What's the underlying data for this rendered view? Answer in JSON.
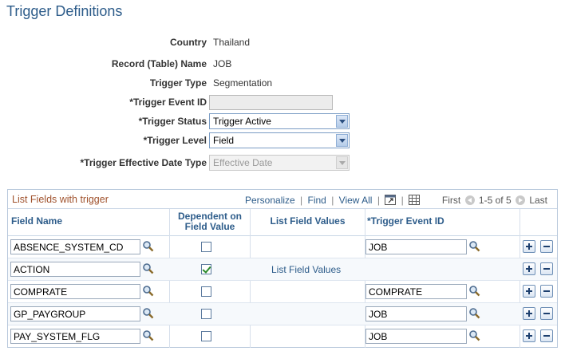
{
  "page": {
    "title": "Trigger Definitions"
  },
  "form": {
    "country": {
      "label": "Country",
      "value": "Thailand"
    },
    "record_name": {
      "label": "Record (Table) Name",
      "value": "JOB"
    },
    "trigger_type": {
      "label": "Trigger Type",
      "value": "Segmentation"
    },
    "trigger_event_id": {
      "label": "*Trigger Event ID",
      "value": ""
    },
    "trigger_status": {
      "label": "*Trigger Status",
      "value": "Trigger Active"
    },
    "trigger_level": {
      "label": "*Trigger Level",
      "value": "Field"
    },
    "trigger_eff_date_type": {
      "label": "*Trigger Effective Date Type",
      "value": "Effective Date"
    }
  },
  "grid": {
    "title": "List Fields with trigger",
    "nav": {
      "personalize": "Personalize",
      "find": "Find",
      "view_all": "View All",
      "separator": "|"
    },
    "pager": {
      "first": "First",
      "range": "1-5 of 5",
      "last": "Last"
    },
    "columns": {
      "field_name": "Field Name",
      "dependent_line1": "Dependent on",
      "dependent_line2": "Field Value",
      "list_field_values": "List Field Values",
      "trigger_event_id": "*Trigger Event ID"
    },
    "rows": [
      {
        "field_name": "ABSENCE_SYSTEM_CD",
        "dependent": false,
        "list_link": "",
        "event_id": "JOB"
      },
      {
        "field_name": "ACTION",
        "dependent": true,
        "list_link": "List Field Values",
        "event_id": ""
      },
      {
        "field_name": "COMPRATE",
        "dependent": false,
        "list_link": "",
        "event_id": "COMPRATE"
      },
      {
        "field_name": "GP_PAYGROUP",
        "dependent": false,
        "list_link": "",
        "event_id": "JOB"
      },
      {
        "field_name": "PAY_SYSTEM_FLG",
        "dependent": false,
        "list_link": "",
        "event_id": "JOB"
      }
    ]
  },
  "icons": {
    "lookup": "magnifier-icon",
    "zoom": "zoom-grid-icon",
    "download": "download-to-excel-icon",
    "prev": "previous-arrow-icon",
    "next": "next-arrow-icon",
    "add": "add-row-icon",
    "delete": "delete-row-icon",
    "dropdown": "chevron-down-icon"
  },
  "colors": {
    "title": "#2d5c8a",
    "grid_title": "#a0522d",
    "link": "#2d5c8a"
  }
}
